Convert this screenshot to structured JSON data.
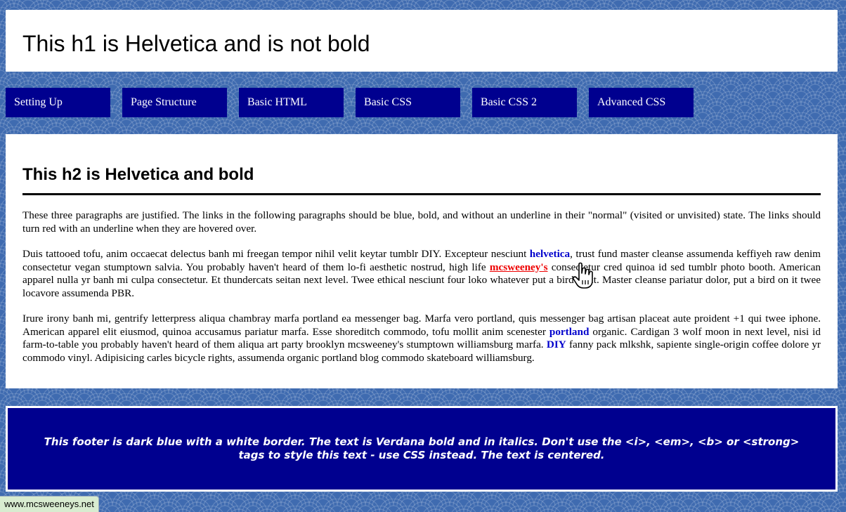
{
  "header": {
    "title": "This h1 is Helvetica and is not bold"
  },
  "nav": {
    "items": [
      {
        "label": "Setting Up"
      },
      {
        "label": "Page Structure"
      },
      {
        "label": "Basic HTML"
      },
      {
        "label": "Basic CSS"
      },
      {
        "label": "Basic CSS 2"
      },
      {
        "label": "Advanced CSS"
      }
    ]
  },
  "main": {
    "heading": "This h2 is Helvetica and bold",
    "p1": "These three paragraphs are justified. The links in the following paragraphs should be blue, bold, and without an underline in their \"normal\" (visited or unvisited) state. The links should turn red with an underline when they are hovered over.",
    "p2": {
      "t1": "Duis tattooed tofu, anim occaecat delectus banh mi freegan tempor nihil velit keytar tumblr DIY. Excepteur nesciunt ",
      "link1": "helvetica",
      "t2": ", trust fund master cleanse assumenda keffiyeh raw denim consectetur vegan stumptown salvia. You probably haven't heard of them lo-fi aesthetic nostrud, high life ",
      "link2": "mcsweeney's",
      "t3": " consectetur cred quinoa id sed tumblr photo booth. American apparel nulla yr banh mi culpa consectetur. Et thundercats seitan next level. Twee ethical nesciunt four loko whatever put a bird on it. Master cleanse pariatur dolor, put a bird on it twee locavore assumenda PBR."
    },
    "p3": {
      "t1": "Irure irony banh mi, gentrify letterpress aliqua chambray marfa portland ea messenger bag. Marfa vero portland, quis messenger bag artisan placeat aute proident +1 qui twee iphone. American apparel elit eiusmod, quinoa accusamus pariatur marfa. Esse shoreditch commodo, tofu mollit anim scenester ",
      "link1": "portland",
      "t2": " organic. Cardigan 3 wolf moon in next level, nisi id farm-to-table you probably haven't heard of them aliqua art party brooklyn mcsweeney's stumptown williamsburg marfa. ",
      "link2": "DIY",
      "t3": " fanny pack mlkshk, sapiente single-origin coffee dolore yr commodo vinyl. Adipisicing carles bicycle rights, assumenda organic portland blog commodo skateboard williamsburg."
    }
  },
  "footer": {
    "text": "This footer is dark blue with a white border. The text is Verdana bold and in italics. Don't use the <i>, <em>, <b> or <strong> tags to style this text - use CSS instead. The text is centered."
  },
  "status_bar": {
    "url": "www.mcsweeneys.net"
  },
  "colors": {
    "nav_bg": "#00008f",
    "link": "#0000cc",
    "link_hover": "#ee0000",
    "page_bg": "#3f6bb0"
  }
}
